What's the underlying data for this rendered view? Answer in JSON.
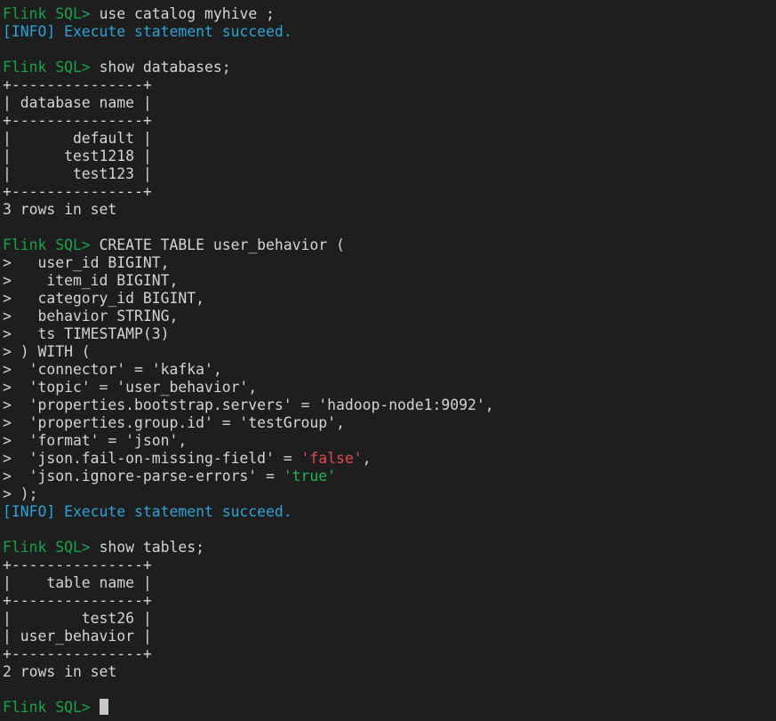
{
  "prompt": "Flink SQL> ",
  "info": "[INFO] Execute statement succeed.",
  "block1": {
    "cmd": "use catalog myhive ;"
  },
  "block2": {
    "cmd": "show databases;",
    "border": "+---------------+",
    "header": "| database name |",
    "rows": [
      "|       default |",
      "|      test1218 |",
      "|       test123 |"
    ],
    "footer": "3 rows in set"
  },
  "block3": {
    "cmd": "CREATE TABLE user_behavior (",
    "lines": [
      ">   user_id BIGINT,",
      ">    item_id BIGINT,",
      ">   category_id BIGINT,",
      ">   behavior STRING,",
      ">   ts TIMESTAMP(3)",
      "> ) WITH (",
      ">  'connector' = 'kafka',",
      ">  'topic' = 'user_behavior',",
      ">  'properties.bootstrap.servers' = 'hadoop-node1:9092',",
      ">  'properties.group.id' = 'testGroup',",
      ">  'format' = 'json',"
    ],
    "missing_field_prefix": ">  'json.fail-on-missing-field' = ",
    "missing_field_value": "'false'",
    "missing_field_suffix": ",",
    "ignore_errors_prefix": ">  'json.ignore-parse-errors' = ",
    "ignore_errors_value": "'true'",
    "close": "> );"
  },
  "block4": {
    "cmd": "show tables;",
    "border": "+---------------+",
    "header": "|    table name |",
    "rows": [
      "|        test26 |",
      "| user_behavior |"
    ],
    "footer": "2 rows in set"
  },
  "colors": {
    "background": "#1e1e1e",
    "prompt": "#16a34a",
    "info": "#2aa3d8",
    "false_literal": "#e5484d",
    "true_literal": "#22b35a"
  }
}
